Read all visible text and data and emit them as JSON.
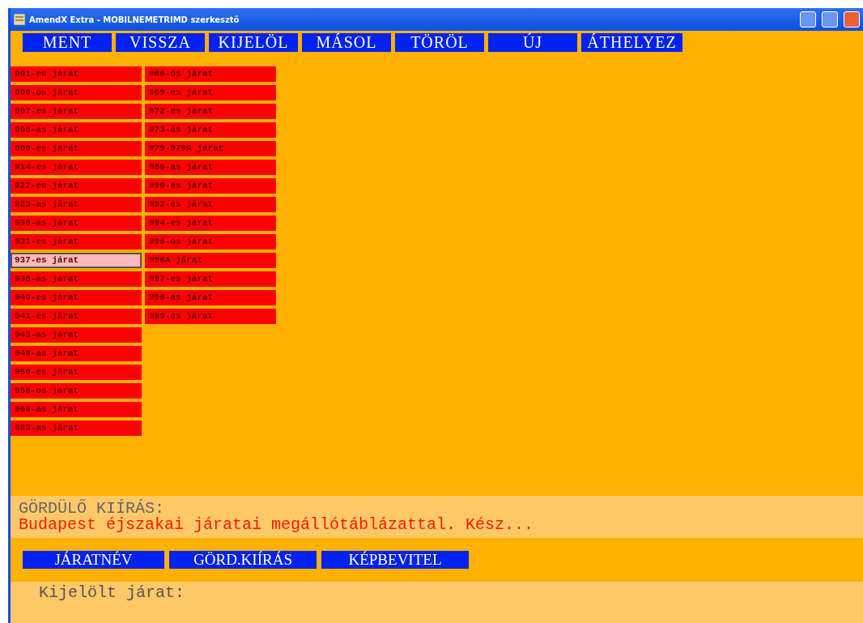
{
  "window": {
    "title": "AmendX Extra - MOBILNEMETRIMD szerkesztő"
  },
  "menu": [
    "MENT",
    "VISSZA",
    "KIJELÖL",
    "MÁSOL",
    "TÖRÖL",
    "ÚJ",
    "ÁTHELYEZ"
  ],
  "routes": [
    [
      {
        "label": "901-es járat",
        "selected": false
      },
      {
        "label": "906-os járat",
        "selected": false
      },
      {
        "label": "907-es járat",
        "selected": false
      },
      {
        "label": "908-as járat",
        "selected": false
      },
      {
        "label": "909-es járat",
        "selected": false
      },
      {
        "label": "914-es járat",
        "selected": false
      },
      {
        "label": "922-es járat",
        "selected": false
      },
      {
        "label": "923-as járat",
        "selected": false
      },
      {
        "label": "930-as járat",
        "selected": false
      },
      {
        "label": "931-es járat",
        "selected": false
      },
      {
        "label": "937-es járat",
        "selected": true
      },
      {
        "label": "938-as járat",
        "selected": false
      },
      {
        "label": "940-es járat",
        "selected": false
      },
      {
        "label": "941-es járat",
        "selected": false
      },
      {
        "label": "943-as járat",
        "selected": false
      },
      {
        "label": "948-as járat",
        "selected": false
      },
      {
        "label": "950-es járat",
        "selected": false
      },
      {
        "label": "956-os járat",
        "selected": false
      },
      {
        "label": "960-as járat",
        "selected": false
      },
      {
        "label": "963-as járat",
        "selected": false
      }
    ],
    [
      {
        "label": "966-os járat",
        "selected": false
      },
      {
        "label": "969-es járat",
        "selected": false
      },
      {
        "label": "972-es járat",
        "selected": false
      },
      {
        "label": "973-as járat",
        "selected": false
      },
      {
        "label": "979-979A járat",
        "selected": false
      },
      {
        "label": "980-as járat",
        "selected": false
      },
      {
        "label": "990-es járat",
        "selected": false
      },
      {
        "label": "992-es járat",
        "selected": false
      },
      {
        "label": "994-es járat",
        "selected": false
      },
      {
        "label": "996-os járat",
        "selected": false
      },
      {
        "label": "996A járat",
        "selected": false
      },
      {
        "label": "997-es járat",
        "selected": false
      },
      {
        "label": "998-as járat",
        "selected": false
      },
      {
        "label": "999-es járat",
        "selected": false
      }
    ]
  ],
  "ticker": {
    "label": "GÖRDÜLŐ KIÍRÁS:",
    "text": "Budapest éjszakai járatai megállótáblázattal. Kész..."
  },
  "buttons": [
    "JÁRATNÉV",
    "GÖRD.KIÍRÁS",
    "KÉPBEVITEL"
  ],
  "selected_label": "Kijelölt járat:"
}
